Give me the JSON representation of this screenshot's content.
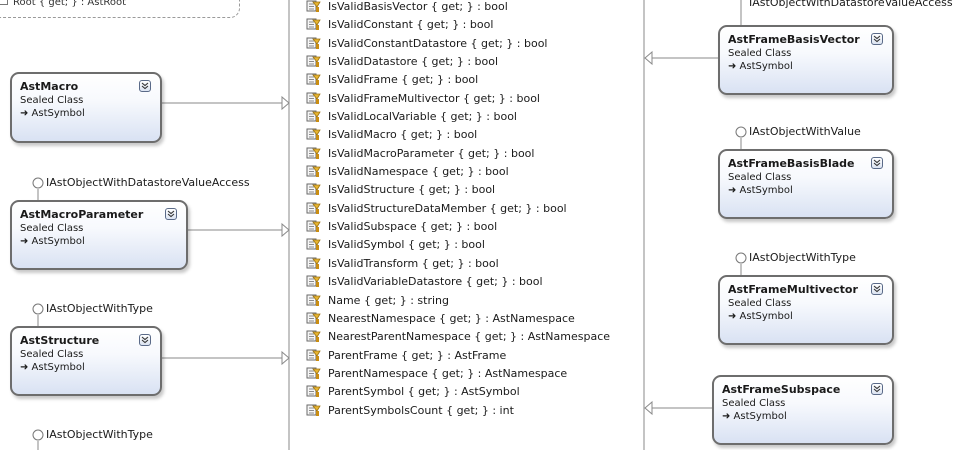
{
  "top_fragment": "Root { get; } : AstRoot",
  "member_icon": "property-icon",
  "members": [
    "IsValidBasisVector { get; } : bool",
    "IsValidConstant { get; } : bool",
    "IsValidConstantDatastore { get; } : bool",
    "IsValidDatastore { get; } : bool",
    "IsValidFrame { get; } : bool",
    "IsValidFrameMultivector { get; } : bool",
    "IsValidLocalVariable { get; } : bool",
    "IsValidMacro { get; } : bool",
    "IsValidMacroParameter { get; } : bool",
    "IsValidNamespace { get; } : bool",
    "IsValidStructure { get; } : bool",
    "IsValidStructureDataMember { get; } : bool",
    "IsValidSubspace { get; } : bool",
    "IsValidSymbol { get; } : bool",
    "IsValidTransform { get; } : bool",
    "IsValidVariableDatastore { get; } : bool",
    "Name { get; } : string",
    "NearestNamespace { get; } : AstNamespace",
    "NearestParentNamespace { get; } : AstNamespace",
    "ParentFrame { get; } : AstFrame",
    "ParentNamespace { get; } : AstNamespace",
    "ParentSymbol { get; } : AstSymbol",
    "ParentSymbolsCount { get; } : int"
  ],
  "interfaces": {
    "left_1": "IAstObjectWithDatastoreValueAccess",
    "left_2": "IAstObjectWithType",
    "left_3": "IAstObjectWithType",
    "right_0": "IAstObjectWithDatastoreValueAccess",
    "right_1": "IAstObjectWithValue",
    "right_2": "IAstObjectWithType"
  },
  "classes": {
    "ast_macro": {
      "name": "AstMacro",
      "kind": "Sealed Class",
      "base": "➜ AstSymbol"
    },
    "ast_macro_parameter": {
      "name": "AstMacroParameter",
      "kind": "Sealed Class",
      "base": "➜ AstSymbol"
    },
    "ast_structure": {
      "name": "AstStructure",
      "kind": "Sealed Class",
      "base": "➜ AstSymbol"
    },
    "ast_frame_basis_vector": {
      "name": "AstFrameBasisVector",
      "kind": "Sealed Class",
      "base": "➜ AstSymbol"
    },
    "ast_frame_basis_blade": {
      "name": "AstFrameBasisBlade",
      "kind": "Sealed Class",
      "base": "➜ AstSymbol"
    },
    "ast_frame_multivector": {
      "name": "AstFrameMultivector",
      "kind": "Sealed Class",
      "base": "➜ AstSymbol"
    },
    "ast_frame_subspace": {
      "name": "AstFrameSubspace",
      "kind": "Sealed Class",
      "base": "➜ AstSymbol"
    }
  },
  "colors": {
    "border": "#6d6d6d",
    "gradient_end": "#d9e2f3",
    "line": "#8a8a8a"
  }
}
